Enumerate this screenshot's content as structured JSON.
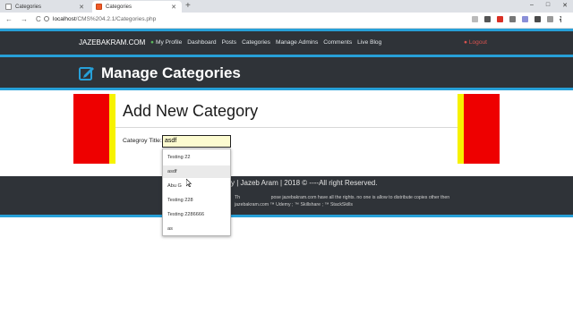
{
  "browser": {
    "tabs": [
      {
        "title": "Categories",
        "active": false
      },
      {
        "title": "Categories",
        "active": true
      }
    ],
    "new_tab": "+",
    "window_controls": [
      "–",
      "□",
      "✕"
    ],
    "nav_glyphs": [
      "←",
      "→",
      "C"
    ],
    "url_host": "localhost",
    "url_path": "/CMS%204.2.1/Categories.php"
  },
  "site_nav": {
    "brand": "JAZEBAKRAM.COM",
    "links": [
      "My Profile",
      "Dashboard",
      "Posts",
      "Categories",
      "Manage Admins",
      "Comments",
      "Live Blog"
    ],
    "logout": "Logout"
  },
  "header": {
    "title": "Manage Categories",
    "icon": "edit-icon"
  },
  "form": {
    "title": "Add New Category",
    "field_label": "Categroy Title:",
    "field_value": "asdf"
  },
  "autocomplete": {
    "options": [
      "Testing 22",
      "asdf",
      "Abu G",
      "Testing 228",
      "Testing 2286666",
      "as"
    ],
    "highlighted_index": 1
  },
  "footer": {
    "line1": "y | Jazeb Aram | 2018 © ----All right Reserved.",
    "line2": "Th                        pose jazebakram.com have all the rights. no one is allow to distribute copies other then",
    "line3": "jazebakram.com ™ Udemy ; ™ Skillshare ; ™ StackSkills"
  },
  "colors": {
    "nav_bg": "#2f3338",
    "accent_blue": "#27a0d8",
    "side_red": "#ee0000",
    "side_yellow": "#f7f200",
    "logout_red": "#d9534f",
    "profile_green": "#5cb85c"
  }
}
